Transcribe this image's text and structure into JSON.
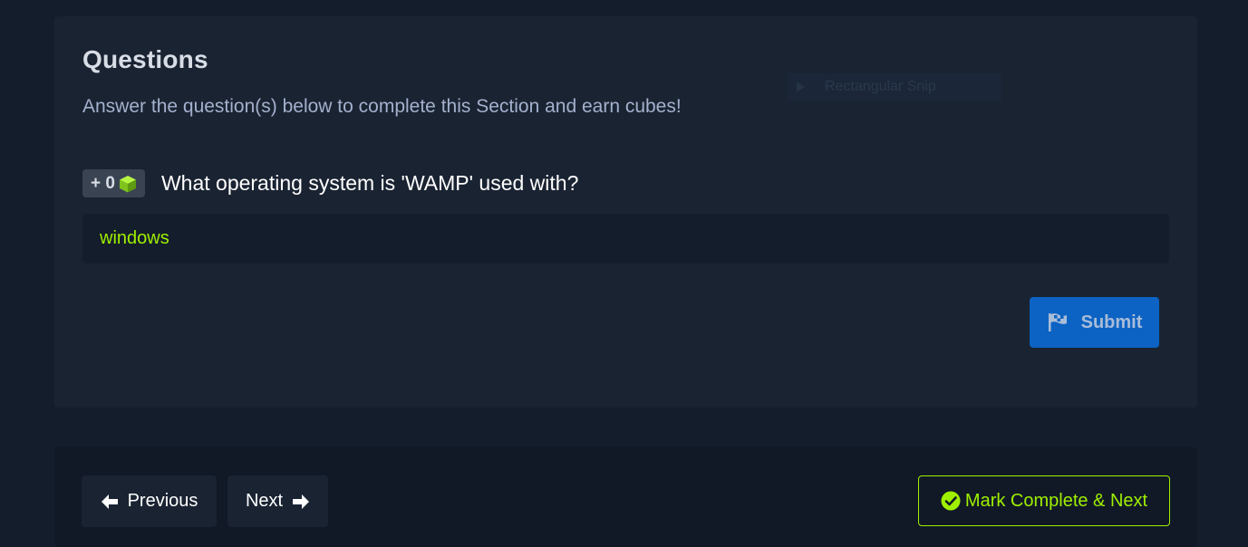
{
  "questions": {
    "title": "Questions",
    "subtitle": "Answer the question(s) below to complete this Section and earn cubes!",
    "snip_overlay_label": "Rectangular Snip",
    "question": {
      "badge": "+ 0",
      "badge_icon": "cube-icon",
      "text": "What operating system is 'WAMP' used with?",
      "answer_value": "windows"
    },
    "submit": {
      "label": "Submit",
      "icon": "flag-icon"
    }
  },
  "navigation": {
    "previous_label": "Previous",
    "next_label": "Next",
    "mark_complete_label": "Mark Complete & Next"
  },
  "colors": {
    "background": "#141d2b",
    "card": "#1a2332",
    "accent_green": "#9fef00",
    "submit_blue": "#0c63c4",
    "subtitle_text": "#a4b1cd"
  }
}
